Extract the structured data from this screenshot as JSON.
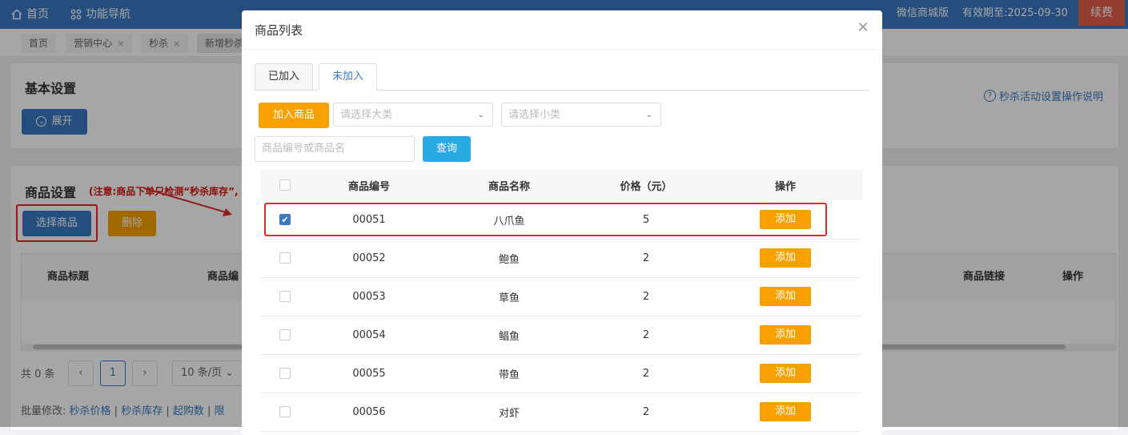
{
  "topbar": {
    "home_label": "首页",
    "nav_label": "功能导航",
    "version_label": "微信商城版",
    "expiry_label": "有效期至:2025-09-30",
    "renew_label": "续费"
  },
  "tags": [
    {
      "label": "首页"
    },
    {
      "label": "营销中心"
    },
    {
      "label": "秒杀"
    },
    {
      "label": "新增秒杀"
    }
  ],
  "basic": {
    "title": "基本设置",
    "expand_label": "展开",
    "help_label": "秒杀活动设置操作说明"
  },
  "goods": {
    "title": "商品设置",
    "note": "(注意:商品下单只检测“秒杀库存”,",
    "select_label": "选择商品",
    "delete_label": "删除",
    "columns": [
      "商品标题",
      "商品编",
      "商品链接",
      "操作"
    ]
  },
  "pager": {
    "total": "共 0 条",
    "page": "1",
    "page_size": "10 条/页"
  },
  "batch": {
    "prefix": "批量修改:",
    "links": [
      "秒杀价格",
      "秒杀库存",
      "起购数",
      "限"
    ]
  },
  "modal": {
    "title": "商品列表",
    "tabs": [
      {
        "label": "已加入",
        "active": false
      },
      {
        "label": "未加入",
        "active": true
      }
    ],
    "add_goods_label": "加入商品",
    "category_placeholder": "请选择大类",
    "subcategory_placeholder": "请选择小类",
    "search_placeholder": "商品编号或商品名",
    "query_label": "查询",
    "table": {
      "headers": [
        "商品编号",
        "商品名称",
        "价格（元）",
        "操作"
      ],
      "rows": [
        {
          "code": "00051",
          "name": "八爪鱼",
          "price": "5",
          "action": "添加",
          "checked": true
        },
        {
          "code": "00052",
          "name": "鲍鱼",
          "price": "2",
          "action": "添加",
          "checked": false
        },
        {
          "code": "00053",
          "name": "草鱼",
          "price": "2",
          "action": "添加",
          "checked": false
        },
        {
          "code": "00054",
          "name": "鲳鱼",
          "price": "2",
          "action": "添加",
          "checked": false
        },
        {
          "code": "00055",
          "name": "带鱼",
          "price": "2",
          "action": "添加",
          "checked": false
        },
        {
          "code": "00056",
          "name": "对虾",
          "price": "2",
          "action": "添加",
          "checked": false
        }
      ]
    }
  },
  "colors": {
    "brand": "#3a78c2",
    "orange": "#f7a000",
    "highlight": "#e02b2b"
  }
}
